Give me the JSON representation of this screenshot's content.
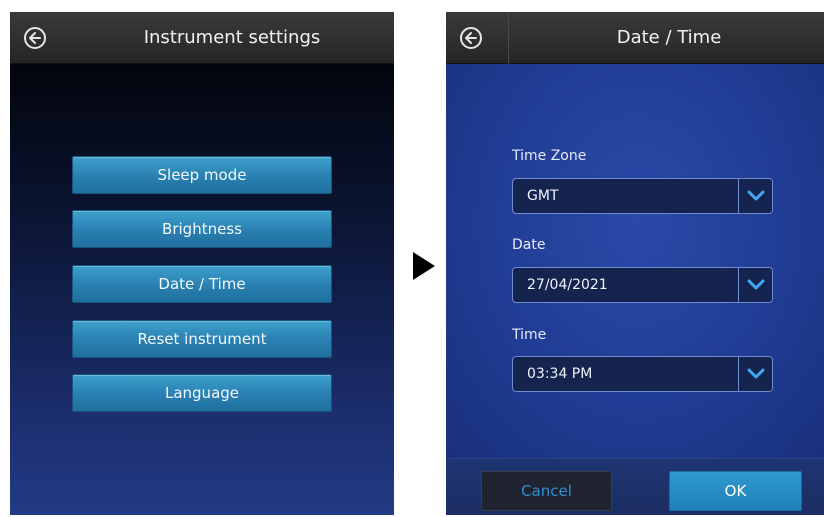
{
  "left_screen": {
    "title": "Instrument settings",
    "menu": [
      {
        "label": "Sleep mode"
      },
      {
        "label": "Brightness"
      },
      {
        "label": "Date / Time"
      },
      {
        "label": "Reset instrument"
      },
      {
        "label": "Language"
      }
    ]
  },
  "right_screen": {
    "title": "Date / Time",
    "fields": {
      "time_zone": {
        "label": "Time Zone",
        "value": "GMT"
      },
      "date": {
        "label": "Date",
        "value": "27/04/2021"
      },
      "time": {
        "label": "Time",
        "value": "03:34 PM"
      }
    },
    "buttons": {
      "cancel": "Cancel",
      "ok": "OK"
    }
  },
  "icons": {
    "back": "back-arrow-circle-icon",
    "dropdown": "chevron-down-icon",
    "transition": "play-triangle-icon"
  },
  "colors": {
    "menu_button": "#2a82b3",
    "ok_button": "#1f80b8",
    "cancel_text": "#2e8fd0",
    "dropdown_accent": "#41a9f0"
  }
}
